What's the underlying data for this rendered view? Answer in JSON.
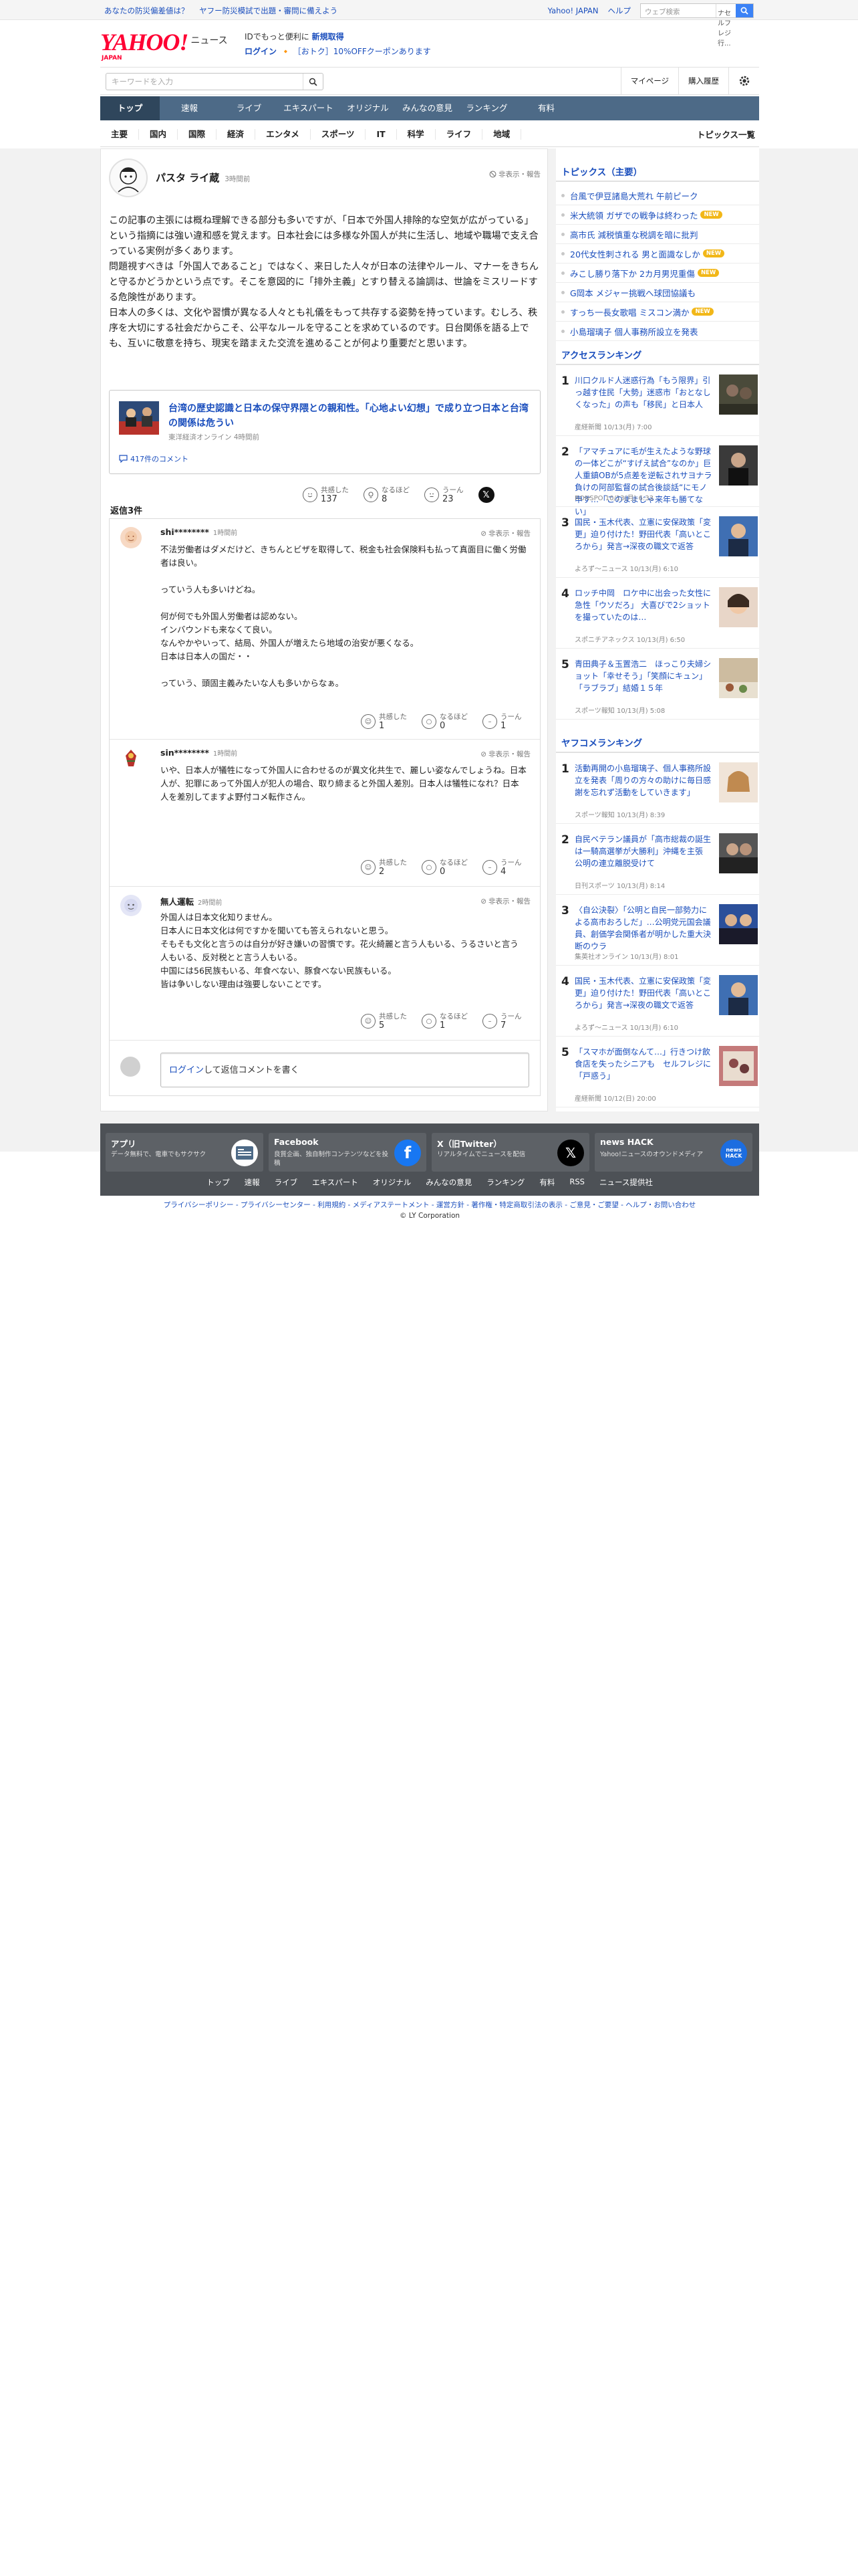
{
  "topstrip": {
    "left_links": [
      "あなたの防災偏差値は？",
      "ヤフー防災模試で出題・審問に備えよう"
    ],
    "right_links": [
      "Yahoo! JAPAN",
      "ヘルプ"
    ],
    "search_placeholder": "ウェブ検索",
    "search_scope": "ナセルフレジ 行..."
  },
  "header": {
    "logo": "YAHOO!",
    "logo_suffix": "ニュース",
    "logo_sub": "JAPAN",
    "promo_line1_prefix": "IDでもっと便利に",
    "promo_line1_link": "新規取得",
    "promo_line2_link": "ログイン",
    "promo_line2_text": "［おトク］10%OFFクーポンあります"
  },
  "searchrow": {
    "placeholder": "キーワードを入力",
    "links": [
      "マイページ",
      "購入履歴"
    ]
  },
  "mainnav": [
    "トップ",
    "速報",
    "ライブ",
    "エキスパート",
    "オリジナル",
    "みんなの意見",
    "ランキング",
    "有料"
  ],
  "subnav": [
    "主要",
    "国内",
    "国際",
    "経済",
    "エンタメ",
    "スポーツ",
    "IT",
    "科学",
    "ライフ",
    "地域"
  ],
  "subnav_all": "トピックス一覧",
  "comment": {
    "user": "パスタ ライ蔵",
    "time": "3時間前",
    "report": "非表示・報告",
    "paragraphs": [
      "この記事の主張には概ね理解できる部分も多いですが、「日本で外国人排除的な空気が広がっている」という指摘には強い違和感を覚えます。日本社会には多様な外国人が共に生活し、地域や職場で支え合っている実例が多くあります。",
      "問題視すべきは「外国人であること」ではなく、来日した人々が日本の法律やルール、マナーをきちんと守るかどうかという点です。そこを意図的に「排外主義」とすり替える論調は、世論をミスリードする危険性があります。",
      "日本人の多くは、文化や習慣が異なる人々とも礼儀をもって共存する姿勢を持っています。むしろ、秩序を大切にする社会だからこそ、公平なルールを守ることを求めているのです。日台関係を語る上でも、互いに敬意を持ち、現実を踏まえた交流を進めることが何より重要だと思います。"
    ],
    "article": {
      "title": "台湾の歴史認識と日本の保守界隈との親和性。「心地よい幻想」で成り立つ日本と台湾の関係は危うい",
      "meta": "東洋経済オンライン 4時間前",
      "comments": "417件のコメント"
    },
    "reactions": [
      {
        "label": "共感した",
        "count": "137"
      },
      {
        "label": "なるほど",
        "count": "8"
      },
      {
        "label": "うーん",
        "count": "23"
      }
    ]
  },
  "replies_header": "返信3件",
  "replies": [
    {
      "user": "shi********",
      "time": "1時間前",
      "report": "非表示・報告",
      "text": "不法労働者はダメだけど、きちんとビザを取得して、税金も社会保険料も払って真面目に働く労働者は良い。\n\nっていう人も多いけどね。\n\n何が何でも外国人労働者は認めない。\nインバウンドも来なくて良い。\nなんやかやいって、結局、外国人が増えたら地域の治安が悪くなる。\n日本は日本人の国だ・・\n\nっていう、頭固主義みたいな人も多いからなぁ。",
      "reactions": [
        {
          "label": "共感した",
          "count": "1"
        },
        {
          "label": "なるほど",
          "count": "0"
        },
        {
          "label": "うーん",
          "count": "1"
        }
      ]
    },
    {
      "user": "sin********",
      "time": "1時間前",
      "report": "非表示・報告",
      "text": "いや、日本人が犠牲になって外国人に合わせるのが異文化共生で、麗しい姿なんでしょうね。日本人が、犯罪にあって外国人が犯人の場合、取り締まると外国人差別。日本人は犠牲になれ？日本人を差別してますよ野付コメ転作さん。",
      "reactions": [
        {
          "label": "共感した",
          "count": "2"
        },
        {
          "label": "なるほど",
          "count": "0"
        },
        {
          "label": "うーん",
          "count": "4"
        }
      ]
    },
    {
      "user": "無人運転",
      "time": "2時間前",
      "report": "非表示・報告",
      "text": "外国人は日本文化知りません。\n日本人に日本文化は何ですかを聞いても答えられないと思う。\nそもそも文化と言うのは自分が好き嫌いの習慣です。花火綺麗と言う人もいる、うるさいと言う人もいる、反対税とと言う人もいる。\n中国には56民族もいる、年食べない、豚食べない民族もいる。\n皆は争いしない理由は強要しないことです。",
      "reactions": [
        {
          "label": "共感した",
          "count": "5"
        },
        {
          "label": "なるほど",
          "count": "1"
        },
        {
          "label": "うーん",
          "count": "7"
        }
      ]
    }
  ],
  "reply_input": {
    "login": "ログイン",
    "rest": "して返信コメントを書く"
  },
  "topics": {
    "title": "トピックス（主要）",
    "items": [
      {
        "text": "台風で伊豆諸島大荒れ 午前ピーク",
        "new": false
      },
      {
        "text": "米大統領 ガザでの戦争は終わった",
        "new": true
      },
      {
        "text": "高市氏 減税慎重な税調を暗に批判",
        "new": false
      },
      {
        "text": "20代女性刺される 男と面識なしか",
        "new": true
      },
      {
        "text": "みこし勝り落下か 2カ月男児重傷",
        "new": true
      },
      {
        "text": "G岡本 メジャー挑戦へ球団協議も",
        "new": false
      },
      {
        "text": "すっち一長女歌唱 ミスコン満か",
        "new": true
      },
      {
        "text": "小島瑠璃子 個人事務所設立を発表",
        "new": false
      }
    ],
    "new_badge": "NEW"
  },
  "access_ranking": {
    "title": "アクセスランキング",
    "items": [
      {
        "num": "1",
        "title": "川口クルド人迷惑行為「もう限界」引っ越す住民「大勢」迷惑市「おとなしくなった」の声も「移民」と日本人",
        "meta": "産経新聞 10/13(月) 7:00"
      },
      {
        "num": "2",
        "title": "「アマチュアに毛が生えたような野球の一体どこが“すげえ試合”なのか」巨人重鎮OBが5点差を逆転されサヨナラ負けの阿部監督の試合後談話“にモノ申す…「このままじゃ来年も勝てない」",
        "meta": "RONSPO 10/13(月) 6:33"
      },
      {
        "num": "3",
        "title": "国民・玉木代表、立憲に安保政策「変更」迫り付けた！野田代表「高いところから」発言→深夜の職文で返答",
        "meta": "よろず～ニュース 10/13(月) 6:10"
      },
      {
        "num": "4",
        "title": "ロッチ中岡　ロケ中に出会った女性に急性「ウソだろ」 大喜びで2ショットを撮っていたのは…",
        "meta": "スポニチアネックス 10/13(月) 6:50"
      },
      {
        "num": "5",
        "title": "青田典子＆玉置浩二　ほっこり夫婦ショット「幸せそう」「笑顔にキュン」「ラブラブ」結婚１５年",
        "meta": "スポーツ報知 10/13(月) 5:08"
      }
    ]
  },
  "yahoo_ranking": {
    "title": "ヤフコメランキング",
    "items": [
      {
        "num": "1",
        "title": "活動再開の小島瑠璃子、個人事務所設立を発表「周りの方々の助けに毎日感謝を忘れず活動をしていきます」",
        "meta": "スポーツ報知 10/13(月) 8:39"
      },
      {
        "num": "2",
        "title": "自民ベテラン議員が「高市総裁の誕生は一騎高選挙が大勝利」沖縄を主張　公明の連立離脱受けて",
        "meta": "日刊スポーツ 10/13(月) 8:14"
      },
      {
        "num": "3",
        "title": "〈自公決裂〉「公明と自民一部勢力による高市おろしだ」…公明党元国会議員、創価学会関係者が明かした重大決断のウラ",
        "meta": "集英社オンライン 10/13(月) 8:01"
      },
      {
        "num": "4",
        "title": "国民・玉木代表、立憲に安保政策「変更」迫り付けた！野田代表「高いところから」発言→深夜の職文で返答",
        "meta": "よろず～ニュース 10/13(月) 6:10"
      },
      {
        "num": "5",
        "title": "「スマホが面倒なんて…」行きつけ飲食店を失ったシニアも　セルフレジに「戸惑う」",
        "meta": "産経新聞 10/12(日) 20:00"
      }
    ]
  },
  "footer": {
    "cards": [
      {
        "title": "アプリ",
        "desc": "データ無料で、電車でもサクサク",
        "icon": "news-app-icon"
      },
      {
        "title": "Facebook",
        "desc": "良質企画、独自制作コンテンツなどを投稿",
        "icon": "facebook-icon"
      },
      {
        "title": "X（旧Twitter）",
        "desc": "リアルタイムでニュースを配信",
        "icon": "x-icon"
      },
      {
        "title": "news HACK",
        "desc": "Yahoo!ニュースのオウンドメディア",
        "icon": "newshack-icon"
      }
    ],
    "links": [
      "トップ",
      "速報",
      "ライブ",
      "エキスパート",
      "オリジナル",
      "みんなの意見",
      "ランキング",
      "有料",
      "RSS",
      "ニュース提供社"
    ],
    "policy": "プライバシーポリシー - プライバシーセンター - 利用規約 - メディアステートメント - 運営方針 - 著作権・特定商取引法の表示 - ご意見・ご要望 - ヘルプ・お問い合わせ",
    "copyright": "© LY Corporation"
  },
  "colors": {
    "accent": "#1a4ebd",
    "nav": "#4d6a87",
    "brand": "#ff0033",
    "footer": "#4d5156"
  }
}
